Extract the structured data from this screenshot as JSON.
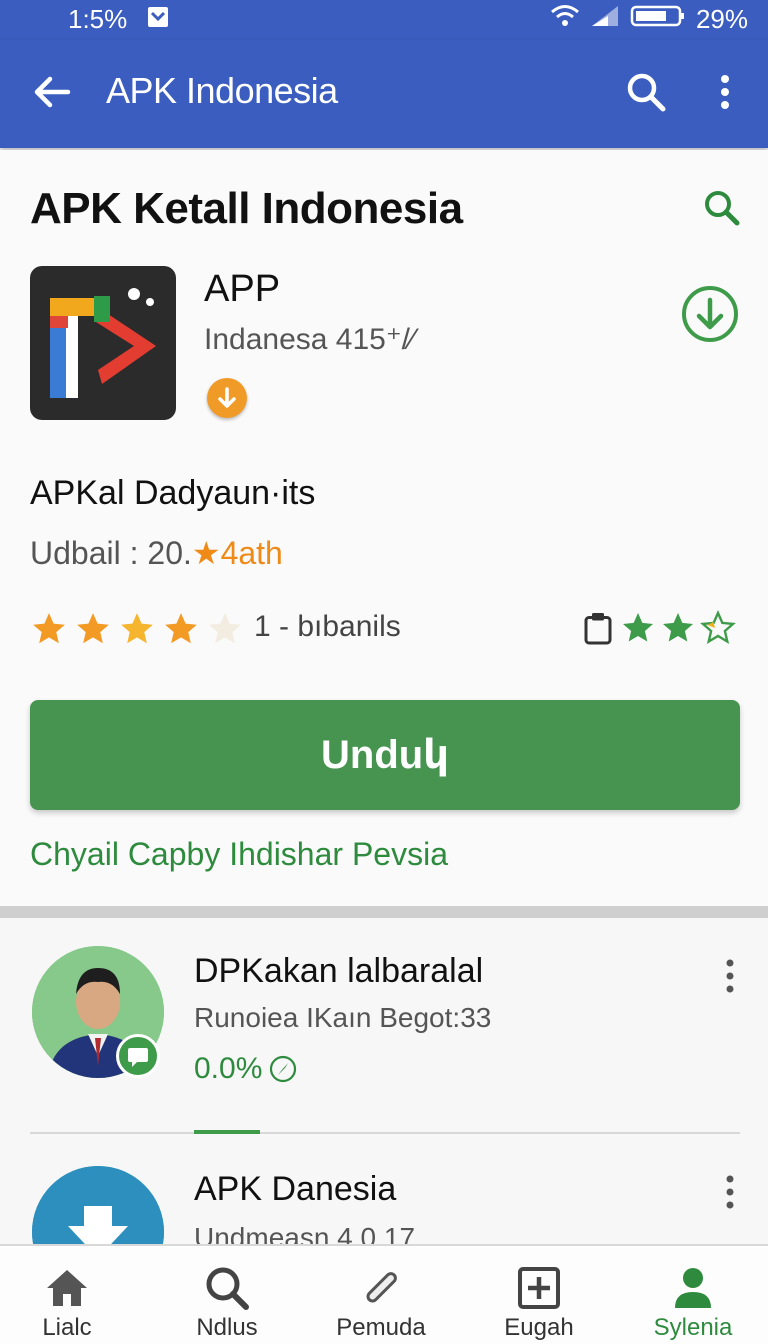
{
  "status_bar": {
    "left_text": "1:5%",
    "battery": "29%"
  },
  "app_bar": {
    "title": "APK Indonesia"
  },
  "page": {
    "title": "APK Ketall Indonesia"
  },
  "app": {
    "name": "APP",
    "subtitle": "Indanesa 415⁺/⁄"
  },
  "details": {
    "heading": "APKal Dadyaun·its",
    "update_label": "Udbail : 20.",
    "update_accent": "★4ath",
    "rating_stars": 4,
    "rating_text": "1 - bıbanils",
    "right_stars": 2.5
  },
  "download_button": {
    "label": "Unduկ"
  },
  "link": {
    "text": "Chyail Capby Ihdishar Pevsia"
  },
  "list_items": [
    {
      "title": "DPKakan lalbaralal",
      "subtitle": "Runoiea IKaın Begot:33",
      "percent": "0.0%"
    },
    {
      "title": "APK Danesia",
      "subtitle": "Undmeasn 4.0.17"
    }
  ],
  "bottom_nav": [
    {
      "label": "Lialc",
      "icon": "home-icon"
    },
    {
      "label": "Ndlus",
      "icon": "search-icon"
    },
    {
      "label": "Pemuda",
      "icon": "pencil-icon"
    },
    {
      "label": "Eugah",
      "icon": "add-box-icon"
    },
    {
      "label": "Sylenia",
      "icon": "person-icon"
    }
  ],
  "colors": {
    "app_bar": "#3a5dbf",
    "primary_green": "#479451",
    "star_orange": "#f39a25",
    "accent_orange": "#ef8a17"
  }
}
